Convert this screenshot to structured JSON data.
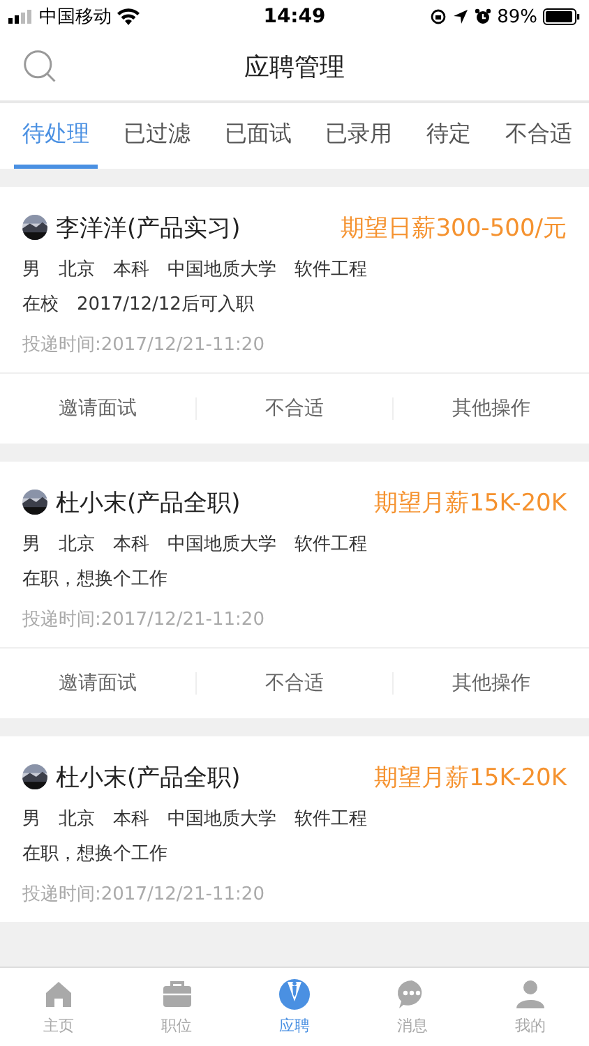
{
  "status_bar": {
    "carrier": "中国移动",
    "time": "14:49",
    "battery": "89%"
  },
  "header": {
    "title": "应聘管理"
  },
  "tabs": [
    {
      "label": "待处理",
      "selected": true
    },
    {
      "label": "已过滤",
      "selected": false
    },
    {
      "label": "已面试",
      "selected": false
    },
    {
      "label": "已录用",
      "selected": false
    },
    {
      "label": "待定",
      "selected": false
    },
    {
      "label": "不合适",
      "selected": false
    }
  ],
  "applications": [
    {
      "name": "李洋洋(产品实习)",
      "salary": "期望日薪300-500/元",
      "details": [
        "男",
        "北京",
        "本科",
        "中国地质大学",
        "软件工程"
      ],
      "status": [
        "在校",
        "2017/12/12后可入职"
      ],
      "submitted": "投递时间:2017/12/21-11:20",
      "actions": [
        "邀请面试",
        "不合适",
        "其他操作"
      ]
    },
    {
      "name": "杜小末(产品全职)",
      "salary": "期望月薪15K-20K",
      "details": [
        "男",
        "北京",
        "本科",
        "中国地质大学",
        "软件工程"
      ],
      "status": [
        "在职，想换个工作"
      ],
      "submitted": "投递时间:2017/12/21-11:20",
      "actions": [
        "邀请面试",
        "不合适",
        "其他操作"
      ]
    },
    {
      "name": "杜小末(产品全职)",
      "salary": "期望月薪15K-20K",
      "details": [
        "男",
        "北京",
        "本科",
        "中国地质大学",
        "软件工程"
      ],
      "status": [
        "在职，想换个工作"
      ],
      "submitted": "投递时间:2017/12/21-11:20"
    }
  ],
  "tab_bar": [
    {
      "kind": "home",
      "label": "主页",
      "selected": false
    },
    {
      "kind": "briefcase",
      "label": "职位",
      "selected": false
    },
    {
      "kind": "tie",
      "label": "应聘",
      "selected": true
    },
    {
      "kind": "chat",
      "label": "消息",
      "selected": false
    },
    {
      "kind": "person",
      "label": "我的",
      "selected": false
    }
  ]
}
